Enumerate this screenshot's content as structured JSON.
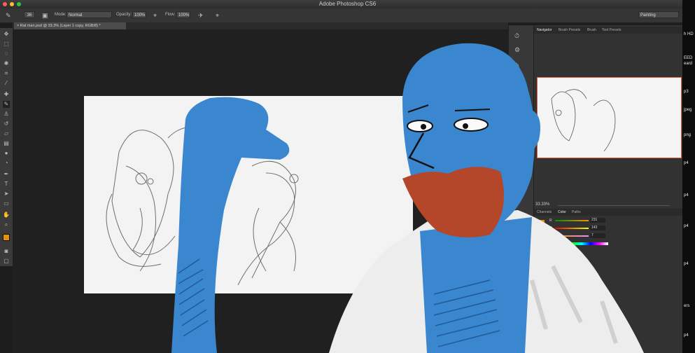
{
  "window": {
    "title": "Adobe Photoshop CS6"
  },
  "options_bar": {
    "brush_size": "36",
    "mode_label": "Mode:",
    "mode_value": "Normal",
    "opacity_label": "Opacity:",
    "opacity_value": "100%",
    "flow_label": "Flow:",
    "flow_value": "100%",
    "workspace_value": "Painting"
  },
  "document": {
    "tab_label": "Rat man.psd @ 33.3% (Layer 1 copy, RGB/8) *"
  },
  "navigator": {
    "tabs": [
      "Navigator",
      "Brush Presets",
      "Brush",
      "Tool Presets"
    ],
    "zoom": "33.33%"
  },
  "color_panel": {
    "tabs": [
      "Channels",
      "Color",
      "Paths"
    ],
    "r_label": "R",
    "r_value": "231",
    "g_label": "G",
    "g_value": "143",
    "b_label": "B",
    "b_value": "7"
  },
  "desktop_labels": [
    "h HD",
    "EED",
    "eard",
    "p3",
    "jpeg",
    "png",
    "p4",
    "p4",
    "p4",
    "p4",
    "ers",
    "p4"
  ],
  "colors": {
    "foreground": "#e78f07",
    "character_skin": "#3a87cf",
    "beard": "#b4462a",
    "shirt": "#ededed"
  }
}
